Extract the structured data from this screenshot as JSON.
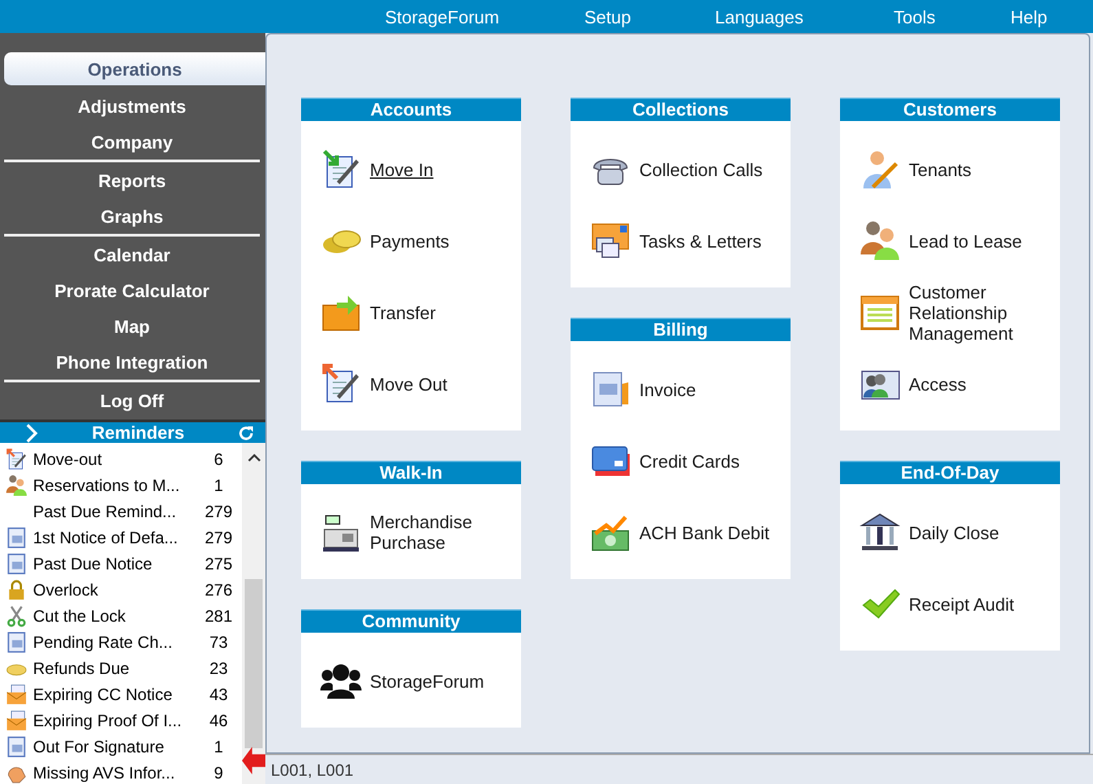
{
  "menu": [
    "StorageForum",
    "Setup",
    "Languages",
    "Tools",
    "Help"
  ],
  "nav_groups": [
    [
      {
        "label": "Operations",
        "selected": true
      },
      {
        "label": "Adjustments",
        "selected": false
      },
      {
        "label": "Company",
        "selected": false
      }
    ],
    [
      {
        "label": "Reports",
        "selected": false
      },
      {
        "label": "Graphs",
        "selected": false
      }
    ],
    [
      {
        "label": "Calendar",
        "selected": false
      },
      {
        "label": "Prorate Calculator",
        "selected": false
      },
      {
        "label": "Map",
        "selected": false
      },
      {
        "label": "Phone Integration",
        "selected": false
      }
    ],
    [
      {
        "label": "Log Off",
        "selected": false
      }
    ]
  ],
  "reminders": {
    "title": "Reminders",
    "items": [
      {
        "label": "Move-out",
        "count": "6"
      },
      {
        "label": "Reservations to M...",
        "count": "1"
      },
      {
        "label": "Past Due Remind...",
        "count": "279"
      },
      {
        "label": "1st Notice of Defa...",
        "count": "279"
      },
      {
        "label": "Past Due Notice",
        "count": "275"
      },
      {
        "label": "Overlock",
        "count": "276"
      },
      {
        "label": "Cut the Lock",
        "count": "281"
      },
      {
        "label": "Pending Rate Ch...",
        "count": "73"
      },
      {
        "label": "Refunds Due",
        "count": "23"
      },
      {
        "label": "Expiring CC Notice",
        "count": "43"
      },
      {
        "label": "Expiring Proof Of I...",
        "count": "46"
      },
      {
        "label": "Out For Signature",
        "count": "1"
      },
      {
        "label": "Missing AVS Infor...",
        "count": "9"
      }
    ]
  },
  "columns": [
    [
      {
        "title": "Accounts",
        "items": [
          {
            "label": "Move In",
            "hovered": true
          },
          {
            "label": "Payments",
            "hovered": false
          },
          {
            "label": "Transfer",
            "hovered": false
          },
          {
            "label": "Move Out",
            "hovered": false
          }
        ]
      },
      {
        "title": "Walk-In",
        "items": [
          {
            "label": "Merchandise Purchase",
            "hovered": false
          }
        ]
      },
      {
        "title": "Community",
        "items": [
          {
            "label": "StorageForum",
            "hovered": false
          }
        ]
      }
    ],
    [
      {
        "title": "Collections",
        "items": [
          {
            "label": "Collection Calls",
            "hovered": false
          },
          {
            "label": "Tasks & Letters",
            "hovered": false
          }
        ]
      },
      {
        "title": "Billing",
        "items": [
          {
            "label": "Invoice",
            "hovered": false
          },
          {
            "label": "Credit Cards",
            "hovered": false
          },
          {
            "label": "ACH Bank Debit",
            "hovered": false
          }
        ]
      }
    ],
    [
      {
        "title": "Customers",
        "items": [
          {
            "label": "Tenants",
            "hovered": false
          },
          {
            "label": "Lead to Lease",
            "hovered": false
          },
          {
            "label": "Customer Relationship Management",
            "hovered": false
          },
          {
            "label": "Access",
            "hovered": false
          }
        ]
      },
      {
        "title": "End-Of-Day",
        "items": [
          {
            "label": "Daily Close",
            "hovered": false
          },
          {
            "label": "Receipt Audit",
            "hovered": false
          }
        ]
      }
    ]
  ],
  "status_bar": "L001, L001"
}
